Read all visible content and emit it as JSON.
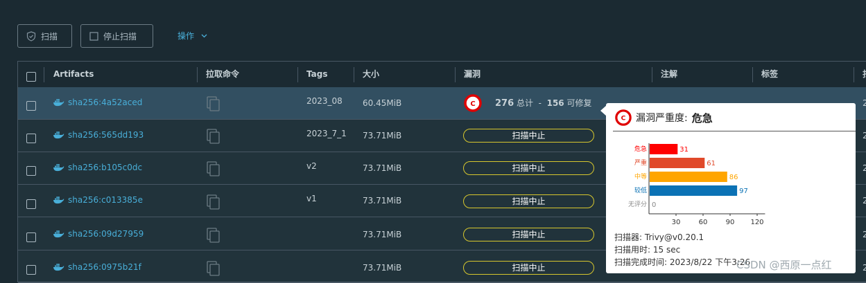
{
  "toolbar": {
    "scan_label": "扫描",
    "stop_label": "停止扫描",
    "actions_label": "操作"
  },
  "columns": [
    "Artifacts",
    "拉取命令",
    "Tags",
    "大小",
    "漏洞",
    "注解",
    "标签",
    "扫"
  ],
  "rows": [
    {
      "artifact": "sha256:4a52aced",
      "tag": "2023_08",
      "size": "60.45MiB",
      "vuln": {
        "total": "276",
        "total_label": "总计",
        "sep": "-",
        "fixable": "156",
        "fixable_label": "可修复"
      }
    },
    {
      "artifact": "sha256:565dd193",
      "tag": "2023_7_1",
      "size": "73.71MiB",
      "status": "扫描中止"
    },
    {
      "artifact": "sha256:b105c0dc",
      "tag": "v2",
      "size": "73.71MiB",
      "status": "扫描中止"
    },
    {
      "artifact": "sha256:c013385e",
      "tag": "v1",
      "size": "73.71MiB",
      "status": "扫描中止"
    },
    {
      "artifact": "sha256:09d27959",
      "tag": "",
      "size": "73.71MiB",
      "status": "扫描中止"
    },
    {
      "artifact": "sha256:0975b21f",
      "tag": "",
      "size": "73.71MiB",
      "status": "扫描中止"
    }
  ],
  "right_col_values": [
    "2",
    "2",
    "2",
    "2",
    "2",
    "2"
  ],
  "popover": {
    "title_prefix": "漏洞严重度:",
    "title_value": "危急",
    "severity_letter": "C",
    "scanner_label": "扫描器:",
    "scanner_value": "Trivy@v0.20.1",
    "duration_label": "扫描用时:",
    "duration_value": "15 sec",
    "completed_label": "扫描完成时间:",
    "completed_value": "2023/8/22 下午3:26"
  },
  "chart_data": {
    "type": "bar",
    "orientation": "horizontal",
    "categories": [
      "危急",
      "严重",
      "中等",
      "较低",
      "无评分"
    ],
    "values": [
      31,
      61,
      86,
      97,
      0
    ],
    "colors": [
      "#ff0000",
      "#e0492a",
      "#ffa500",
      "#0b72b5",
      "#888888"
    ],
    "xticks": [
      30,
      60,
      90,
      120
    ],
    "xlim": [
      0,
      140
    ]
  },
  "watermark": "CSDN @西原一点红"
}
